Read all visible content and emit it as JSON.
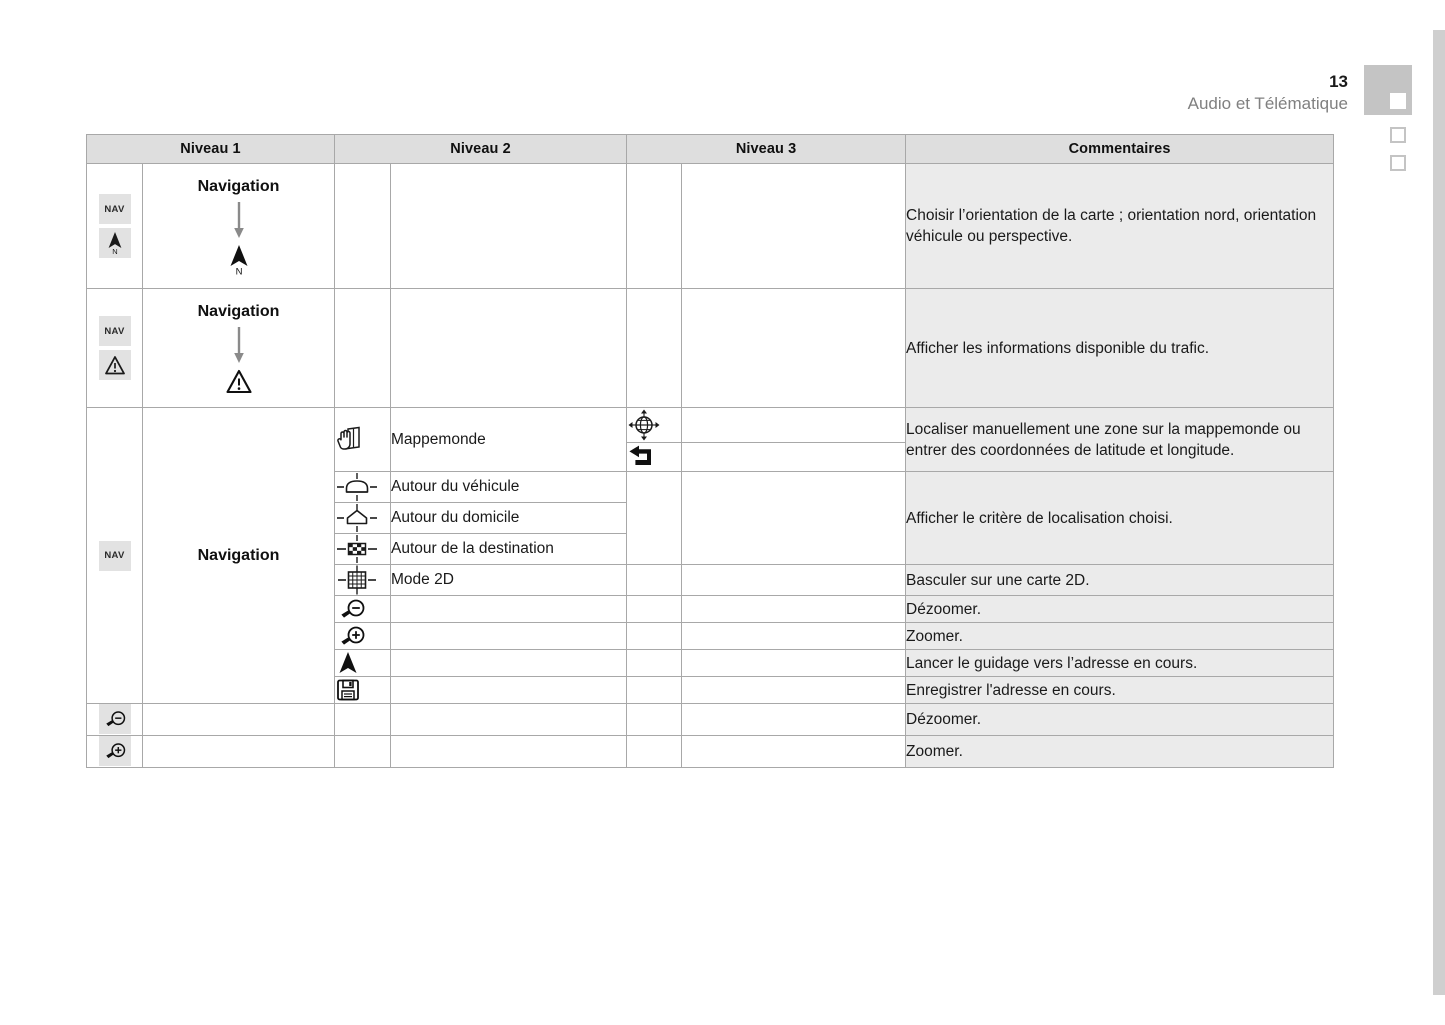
{
  "page": {
    "number": "13",
    "section": "Audio et Télématique"
  },
  "table": {
    "headers": [
      "Niveau 1",
      "Niveau 2",
      "Niveau 3",
      "Commentaires"
    ],
    "rows": [
      {
        "id": "row-orientation",
        "level1_icons": [
          "nav-badge",
          "north-arrow-badge"
        ],
        "level1_label": "Navigation",
        "level1_flow_icon": "north-arrow-icon",
        "level2_icon": "",
        "level2_label": "",
        "level3_icon": "",
        "comment": "Choisir l’orientation de la carte ; orientation nord, orientation véhicule ou perspective."
      },
      {
        "id": "row-traffic",
        "level1_icons": [
          "nav-badge",
          "warning-triangle-badge"
        ],
        "level1_label": "Navigation",
        "level1_flow_icon": "warning-triangle-icon",
        "level2_icon": "",
        "level2_label": "",
        "level3_icon": "",
        "comment": "Afficher les informations disponible du trafic."
      },
      {
        "id": "row-mappemonde-a",
        "level2_icon": "hand-map-icon",
        "level2_label": "Mappemonde",
        "level3_icon": "globe-pan-icon",
        "comment": "Localiser manuellement une zone sur la mappemonde ou entrer des coordonnées de latitude et longitude."
      },
      {
        "id": "row-mappemonde-b",
        "level3_icon": "return-arrow-icon"
      },
      {
        "id": "row-autour-vehicule",
        "level2_icon": "around-vehicle-icon",
        "level2_label": "Autour du véhicule",
        "comment": "Afficher le critère de localisation choisi."
      },
      {
        "id": "row-autour-domicile",
        "level2_icon": "around-home-icon",
        "level2_label": "Autour du domicile"
      },
      {
        "id": "row-autour-destination",
        "level2_icon": "around-destination-icon",
        "level2_label": "Autour de la destination"
      },
      {
        "id": "row-mode-2d",
        "level2_icon": "grid-2d-icon",
        "level2_label": "Mode 2D",
        "comment": "Basculer sur une carte 2D."
      },
      {
        "id": "row-zoom-out-n2",
        "level2_icon": "zoom-out-icon",
        "level2_label": "",
        "comment": "Dézoomer."
      },
      {
        "id": "row-zoom-in-n2",
        "level2_icon": "zoom-in-icon",
        "level2_label": "",
        "comment": "Zoomer."
      },
      {
        "id": "row-guidance",
        "level2_icon": "navigation-arrow-icon",
        "level2_label": "",
        "comment": "Lancer le guidage vers l’adresse en cours."
      },
      {
        "id": "row-save",
        "level2_icon": "floppy-save-icon",
        "level2_label": "",
        "comment": "Enregistrer l'adresse en cours."
      },
      {
        "id": "row-zoom-out-n1",
        "level1_icons": [
          "zoom-out-badge"
        ],
        "comment": "Dézoomer."
      },
      {
        "id": "row-zoom-in-n1",
        "level1_icons": [
          "zoom-in-badge"
        ],
        "comment": "Zoomer."
      }
    ],
    "group_label": "Navigation",
    "group_icon": "nav-badge"
  }
}
